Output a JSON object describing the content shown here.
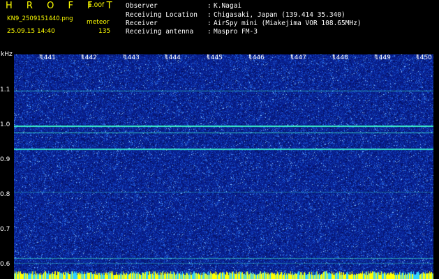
{
  "header": {
    "brand": "H R O F F T",
    "version": "1.00f",
    "filename": "KN9_2509151440.png",
    "mode": "meteor",
    "datetime": "25.09.15 14:40",
    "count": "135"
  },
  "meta": [
    {
      "key": "Observer",
      "value": "K.Nagai"
    },
    {
      "key": "Receiving Location",
      "value": "Chigasaki, Japan (139.414 35.340)"
    },
    {
      "key": "Receiver",
      "value": "AirSpy mini (Miakejima VOR 108.65MHz)"
    },
    {
      "key": "Receiving antenna",
      "value": "Maspro FM-3"
    }
  ],
  "axis": {
    "y_unit": "kHz",
    "y_ticks": [
      "1.1",
      "1.0",
      "0.9",
      "0.8",
      "0.7",
      "0.6"
    ],
    "x_ticks": [
      "1441",
      "1442",
      "1443",
      "1444",
      "1445",
      "1446",
      "1447",
      "1448",
      "1449",
      "1450"
    ]
  },
  "colors": {
    "background": "#082090",
    "noise": "#2a5fd0",
    "line": "#40ffd0",
    "bottom_band": "#ffff00"
  }
}
